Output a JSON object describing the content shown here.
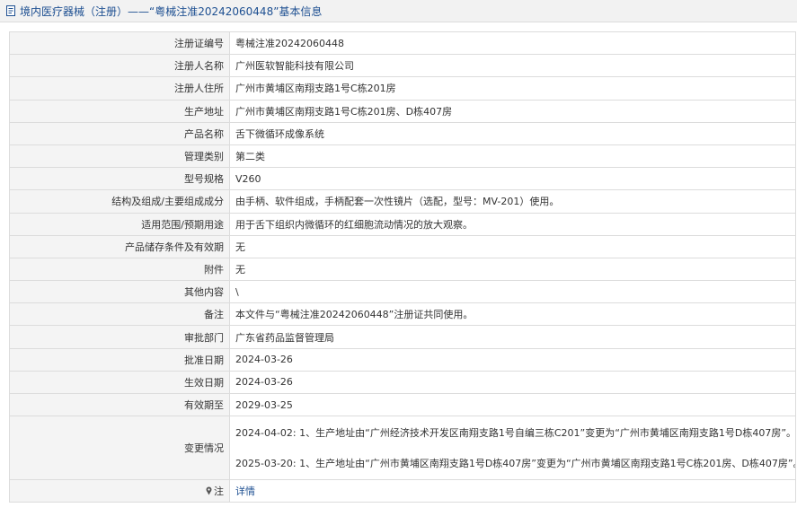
{
  "header": {
    "title": "境内医疗器械（注册）——“粤械注准20242060448”基本信息"
  },
  "rows": [
    {
      "label": "注册证编号",
      "value": "粤械注准20242060448"
    },
    {
      "label": "注册人名称",
      "value": "广州医软智能科技有限公司"
    },
    {
      "label": "注册人住所",
      "value": "广州市黄埔区南翔支路1号C栋201房"
    },
    {
      "label": "生产地址",
      "value": "广州市黄埔区南翔支路1号C栋201房、D栋407房"
    },
    {
      "label": "产品名称",
      "value": "舌下微循环成像系统"
    },
    {
      "label": "管理类别",
      "value": "第二类"
    },
    {
      "label": "型号规格",
      "value": "V260"
    },
    {
      "label": "结构及组成/主要组成成分",
      "value": "由手柄、软件组成，手柄配套一次性镜片（选配，型号：MV-201）使用。"
    },
    {
      "label": "适用范围/预期用途",
      "value": "用于舌下组织内微循环的红细胞流动情况的放大观察。"
    },
    {
      "label": "产品储存条件及有效期",
      "value": "无"
    },
    {
      "label": "附件",
      "value": "无"
    },
    {
      "label": "其他内容",
      "value": "\\"
    },
    {
      "label": "备注",
      "value": "本文件与“粤械注准20242060448”注册证共同使用。"
    },
    {
      "label": "审批部门",
      "value": "广东省药品监督管理局"
    },
    {
      "label": "批准日期",
      "value": "2024-03-26"
    },
    {
      "label": "生效日期",
      "value": "2024-03-26"
    },
    {
      "label": "有效期至",
      "value": "2029-03-25"
    }
  ],
  "changes": {
    "label": "变更情况",
    "items": [
      "2024-04-02: 1、生产地址由“广州经济技术开发区南翔支路1号自编三栋C201”变更为“广州市黄埔区南翔支路1号D栋407房”。",
      "2025-03-20: 1、生产地址由“广州市黄埔区南翔支路1号D栋407房”变更为“广州市黄埔区南翔支路1号C栋201房、D栋407房”。"
    ]
  },
  "note": {
    "label": "注",
    "link": "详情",
    "icon": "pin-icon"
  },
  "colors": {
    "title_text": "#1d4f91",
    "label_bg": "#f4f4f4",
    "border": "#dcdcdc"
  }
}
